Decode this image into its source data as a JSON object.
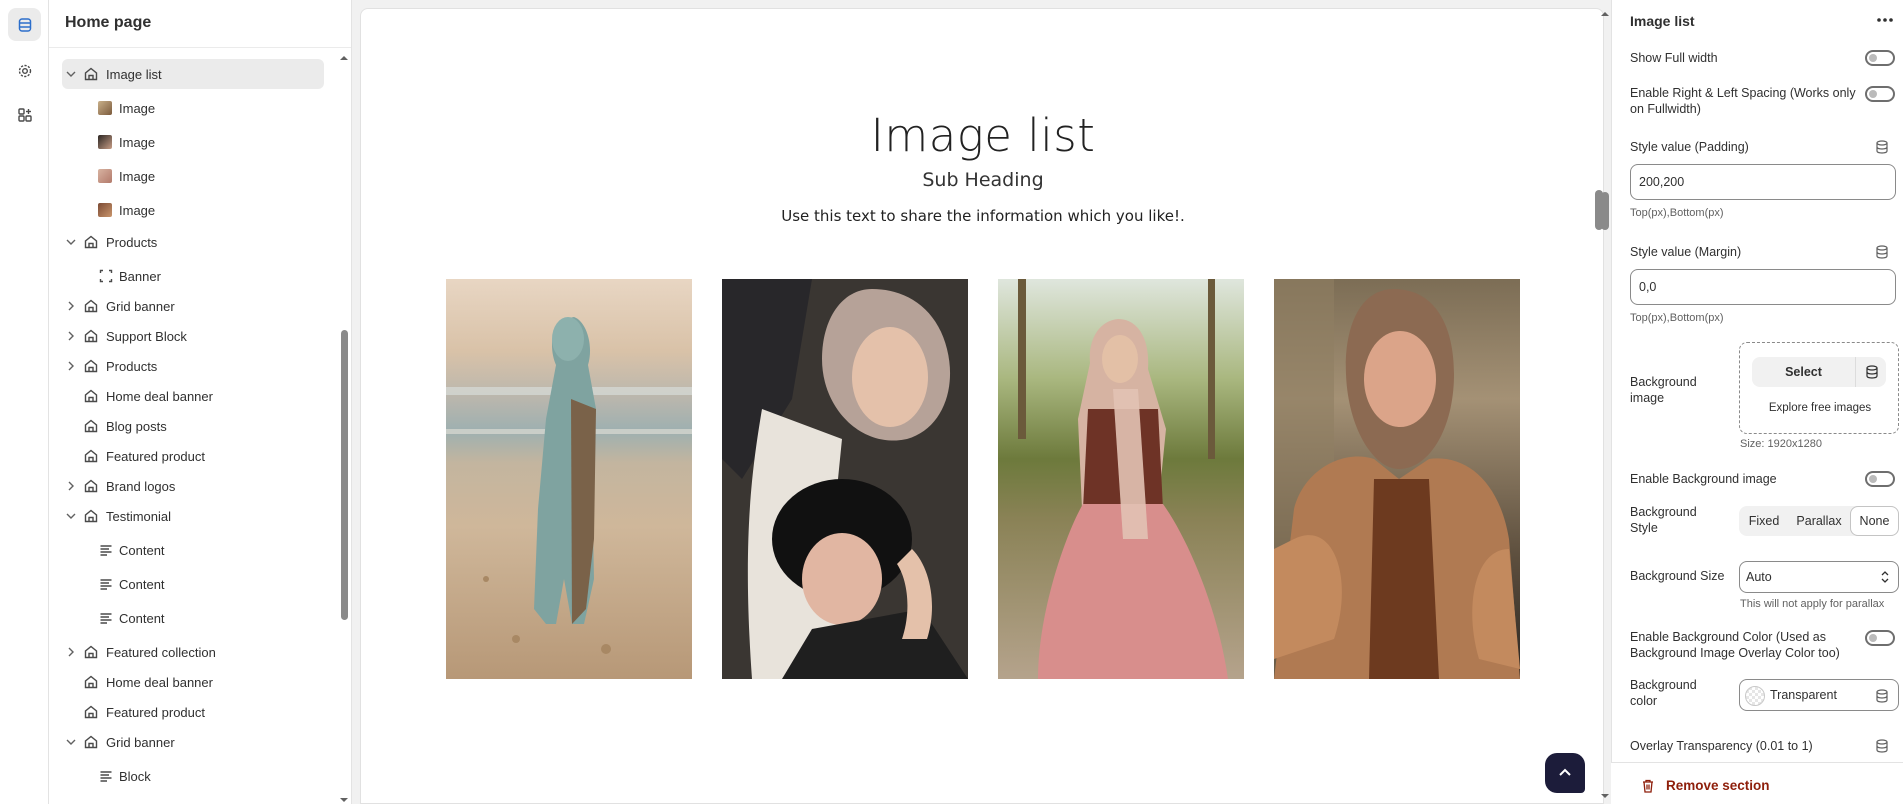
{
  "rail": {
    "items": [
      "sections-icon",
      "gear-icon",
      "apps-icon"
    ]
  },
  "left": {
    "title": "Home page",
    "tree": [
      {
        "label": "Image list",
        "icon": "section-icon",
        "expand": "open",
        "level": 0,
        "selected": true
      },
      {
        "label": "Image",
        "icon": "thumb",
        "level": 1
      },
      {
        "label": "Image",
        "icon": "thumb",
        "level": 1
      },
      {
        "label": "Image",
        "icon": "thumb",
        "level": 1
      },
      {
        "label": "Image",
        "icon": "thumb",
        "level": 1
      },
      {
        "label": "Products",
        "icon": "section-icon",
        "expand": "open",
        "level": 0
      },
      {
        "label": "Banner",
        "icon": "banner-icon",
        "level": 1
      },
      {
        "label": "Grid banner",
        "icon": "section-icon",
        "expand": "closed",
        "level": 0
      },
      {
        "label": "Support Block",
        "icon": "section-icon",
        "expand": "closed",
        "level": 0
      },
      {
        "label": "Products",
        "icon": "section-icon",
        "expand": "closed",
        "level": 0
      },
      {
        "label": "Home deal banner",
        "icon": "section-icon",
        "level": 0
      },
      {
        "label": "Blog posts",
        "icon": "section-icon",
        "level": 0
      },
      {
        "label": "Featured product",
        "icon": "section-icon",
        "level": 0
      },
      {
        "label": "Brand logos",
        "icon": "section-icon",
        "expand": "closed",
        "level": 0
      },
      {
        "label": "Testimonial",
        "icon": "section-icon",
        "expand": "open",
        "level": 0
      },
      {
        "label": "Content",
        "icon": "text-icon",
        "level": 1
      },
      {
        "label": "Content",
        "icon": "text-icon",
        "level": 1
      },
      {
        "label": "Content",
        "icon": "text-icon",
        "level": 1
      },
      {
        "label": "Featured collection",
        "icon": "section-icon",
        "expand": "closed",
        "level": 0
      },
      {
        "label": "Home deal banner",
        "icon": "section-icon",
        "level": 0
      },
      {
        "label": "Featured product",
        "icon": "section-icon",
        "level": 0
      },
      {
        "label": "Grid banner",
        "icon": "section-icon",
        "expand": "open",
        "level": 0
      },
      {
        "label": "Block",
        "icon": "text-icon",
        "level": 1
      }
    ]
  },
  "preview": {
    "title": "Image list",
    "subheading": "Sub Heading",
    "text": "Use this text to share the information which you like!.",
    "images": [
      "photo-beach-walk",
      "photo-two-women",
      "photo-pink-skirt",
      "photo-fur-vest"
    ]
  },
  "settings": {
    "title": "Image list",
    "show_full_width": "Show Full width",
    "enable_spacing": "Enable Right & Left Spacing (Works only on Fullwidth)",
    "padding_label": "Style value (Padding)",
    "padding_value": "200,200",
    "padding_hint": "Top(px),Bottom(px)",
    "margin_label": "Style value (Margin)",
    "margin_value": "0,0",
    "margin_hint": "Top(px),Bottom(px)",
    "bg_image_label": "Background image",
    "select_label": "Select",
    "explore_label": "Explore free images",
    "size_hint": "Size: 1920x1280",
    "enable_bg_image": "Enable Background image",
    "bg_style_label": "Background Style",
    "bg_style_options": [
      "Fixed",
      "Parallax",
      "None"
    ],
    "bg_style_selected": "None",
    "bg_size_label": "Background Size",
    "bg_size_value": "Auto",
    "bg_size_hint": "This will not apply for parallax",
    "enable_bg_color": "Enable Background Color (Used as Background Image Overlay Color too)",
    "bg_color_label": "Background color",
    "bg_color_value": "Transparent",
    "overlay_label": "Overlay Transparency (0.01 to 1)",
    "remove_label": "Remove section"
  },
  "colors": {
    "accent_danger": "#8e1f0b",
    "to_top_bg": "#1c1c3a"
  }
}
